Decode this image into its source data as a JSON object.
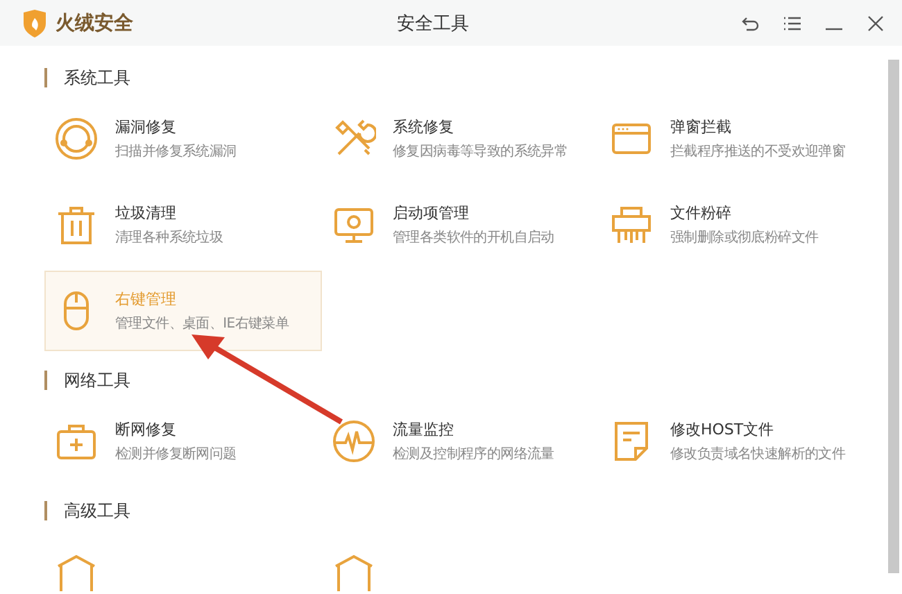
{
  "window": {
    "app_name": "火绒安全",
    "title": "安全工具"
  },
  "sections": [
    {
      "title": "系统工具",
      "items": [
        {
          "name": "漏洞修复",
          "desc": "扫描并修复系统漏洞",
          "selected": false
        },
        {
          "name": "系统修复",
          "desc": "修复因病毒等导致的系统异常",
          "selected": false
        },
        {
          "name": "弹窗拦截",
          "desc": "拦截程序推送的不受欢迎弹窗",
          "selected": false
        },
        {
          "name": "垃圾清理",
          "desc": "清理各种系统垃圾",
          "selected": false
        },
        {
          "name": "启动项管理",
          "desc": "管理各类软件的开机自启动",
          "selected": false
        },
        {
          "name": "文件粉碎",
          "desc": "强制删除或彻底粉碎文件",
          "selected": false
        },
        {
          "name": "右键管理",
          "desc": "管理文件、桌面、IE右键菜单",
          "selected": true
        }
      ]
    },
    {
      "title": "网络工具",
      "items": [
        {
          "name": "断网修复",
          "desc": "检测并修复断网问题",
          "selected": false
        },
        {
          "name": "流量监控",
          "desc": "检测及控制程序的网络流量",
          "selected": false
        },
        {
          "name": "修改HOST文件",
          "desc": "修改负责域名快速解析的文件",
          "selected": false
        }
      ]
    },
    {
      "title": "高级工具",
      "items": [
        {
          "selected": false
        },
        {
          "selected": false
        }
      ]
    }
  ]
}
